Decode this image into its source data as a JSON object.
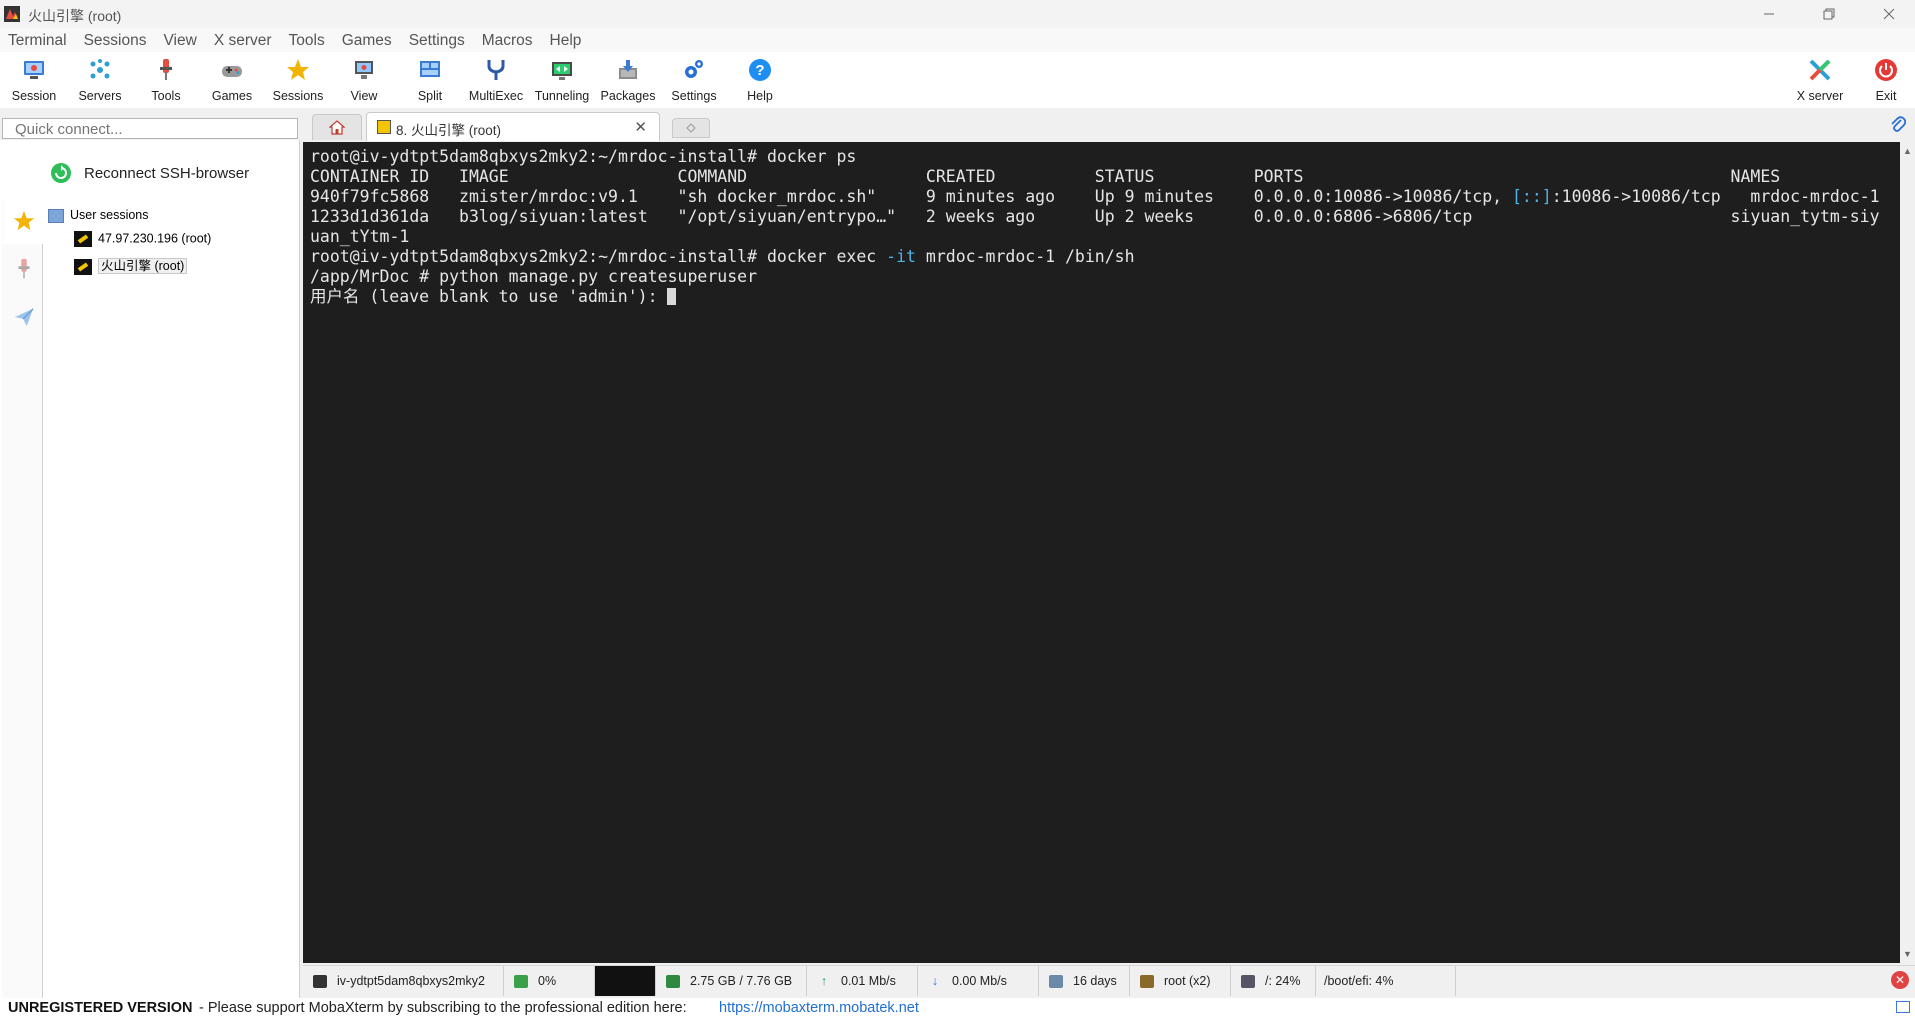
{
  "window": {
    "title": "火山引擎 (root)"
  },
  "menubar": [
    "Terminal",
    "Sessions",
    "View",
    "X server",
    "Tools",
    "Games",
    "Settings",
    "Macros",
    "Help"
  ],
  "toolbar": {
    "buttons": [
      "Session",
      "Servers",
      "Tools",
      "Games",
      "Sessions",
      "View",
      "Split",
      "MultiExec",
      "Tunneling",
      "Packages",
      "Settings",
      "Help"
    ],
    "right_buttons": [
      "X server",
      "Exit"
    ]
  },
  "quick_connect": {
    "placeholder": "Quick connect..."
  },
  "tabs": {
    "active_label": "8. 火山引擎  (root)",
    "close_glyph": "✕"
  },
  "sidebar": {
    "reconnect_label": "Reconnect SSH-browser",
    "group_label": "User sessions",
    "sessions": [
      "47.97.230.196 (root)",
      "火山引擎 (root)"
    ]
  },
  "terminal": {
    "line1": "root@iv-ydtpt5dam8qbxys2mky2:~/mrdoc-install# docker ps",
    "line2": "CONTAINER ID   IMAGE                 COMMAND                  CREATED          STATUS          PORTS                                           NAMES",
    "line3_a": "940f79fc5868   zmister/mrdoc:v9.1    \"sh docker_mrdoc.sh\"     9 minutes ago    Up 9 minutes    0.0.0.0:10086->10086/tcp, ",
    "line3_hl": "[::]",
    "line3_b": ":10086->10086/tcp   mrdoc-mrdoc-1",
    "line4": "1233d1d361da   b3log/siyuan:latest   \"/opt/siyuan/entrypo…\"   2 weeks ago      Up 2 weeks      0.0.0.0:6806->6806/tcp                          siyuan_tytm-siy",
    "line5": "uan_tYtm-1",
    "line6_a": "root@iv-ydtpt5dam8qbxys2mky2:~/mrdoc-install# docker exec ",
    "line6_hl": "-it",
    "line6_b": " mrdoc-mrdoc-1 /bin/sh",
    "line7": "/app/MrDoc # python manage.py createsuperuser",
    "line8": "用户名 (leave blank to use 'admin'): "
  },
  "statusbar": {
    "host": "iv-ydtpt5dam8qbxys2mky2",
    "cpu": "0%",
    "memory": "2.75 GB / 7.76 GB",
    "upload": "0.01 Mb/s",
    "download": "0.00 Mb/s",
    "uptime": "16 days",
    "users": "root (x2)",
    "disk_root": "/: 24%",
    "disk_boot": "/boot/efi: 4%"
  },
  "banner": {
    "unregistered": "UNREGISTERED VERSION",
    "support": "-  Please support MobaXterm by subscribing to the professional edition here:",
    "link": "https://mobaxterm.mobatek.net"
  },
  "colors": {
    "terminal_bg": "#1e1e1e",
    "terminal_fg": "#e6e6e6",
    "highlight": "#4fb3e8",
    "accent_star": "#f2b400"
  }
}
